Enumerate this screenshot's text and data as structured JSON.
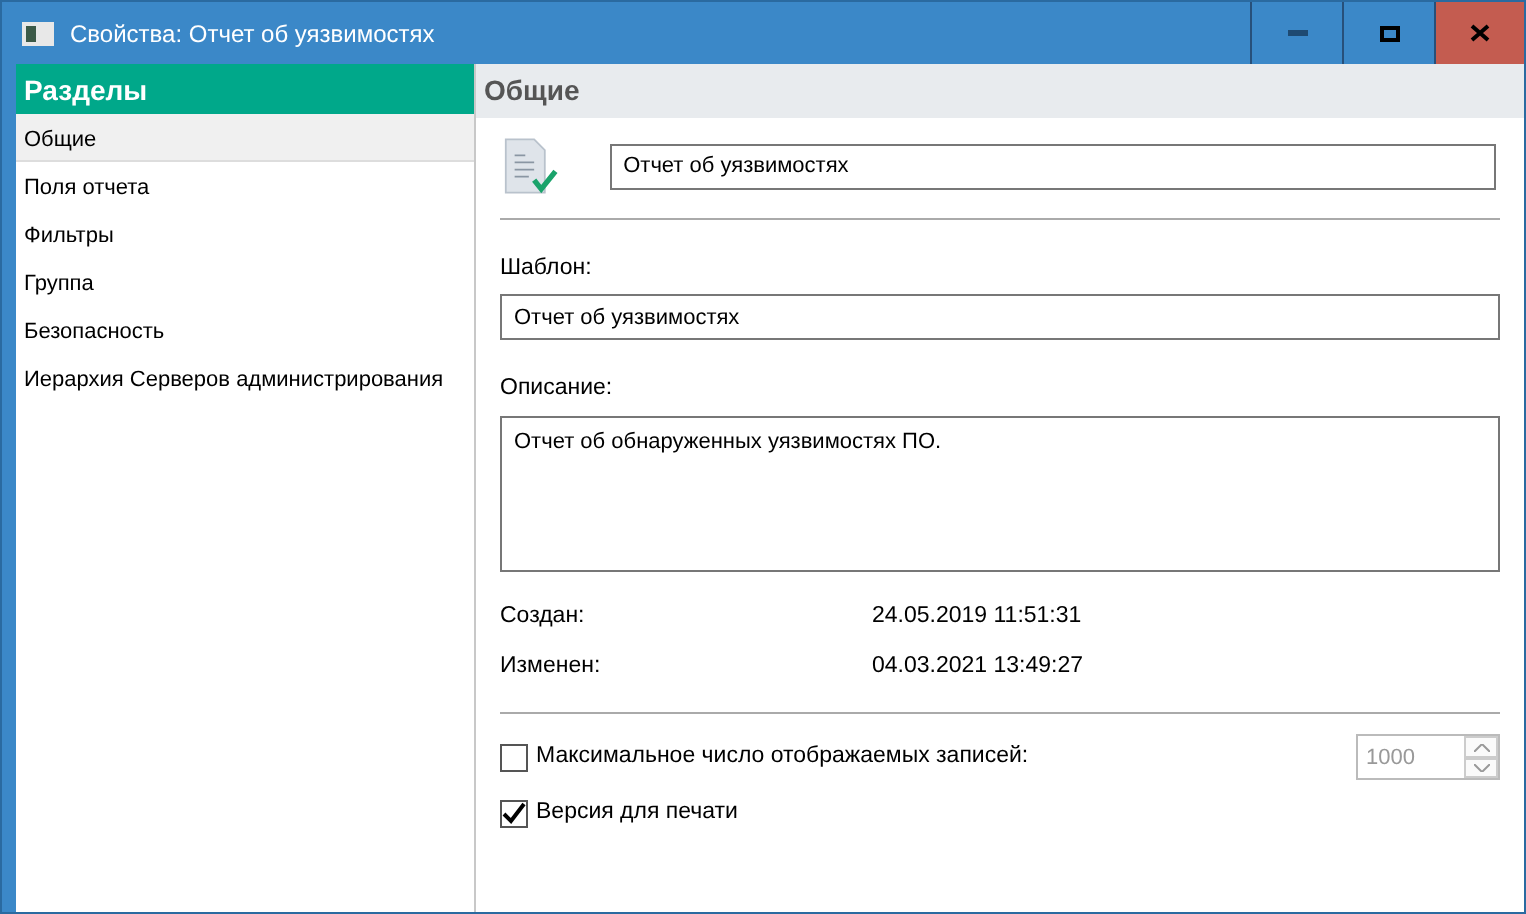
{
  "window": {
    "title": "Свойства: Отчет об уязвимостях"
  },
  "sidebar": {
    "title": "Разделы",
    "items": [
      {
        "label": "Общие",
        "selected": true
      },
      {
        "label": "Поля отчета",
        "selected": false
      },
      {
        "label": "Фильтры",
        "selected": false
      },
      {
        "label": "Группа",
        "selected": false
      },
      {
        "label": "Безопасность",
        "selected": false
      },
      {
        "label": "Иерархия Серверов администрирования",
        "selected": false
      }
    ]
  },
  "panel": {
    "title": "Общие",
    "name_value": "Отчет об уязвимостях",
    "template": {
      "label": "Шаблон:",
      "value": "Отчет об уязвимостях"
    },
    "description": {
      "label": "Описание:",
      "value": "Отчет об обнаруженных уязвимостях ПО."
    },
    "info": [
      {
        "label": "Создан:",
        "value": "24.05.2019 11:51:31"
      },
      {
        "label": "Изменен:",
        "value": "04.03.2021 13:49:27"
      }
    ],
    "max_records": {
      "label": "Максимальное число отображаемых записей:",
      "checked": false,
      "value": "1000",
      "disabled": true
    },
    "print_version": {
      "label": "Версия для печати",
      "checked": true
    }
  }
}
